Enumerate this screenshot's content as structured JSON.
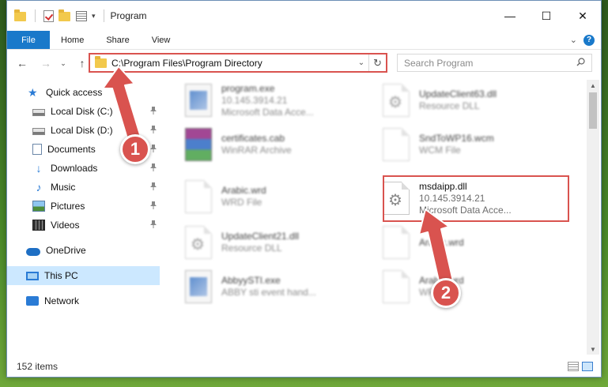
{
  "window": {
    "title": "Program",
    "controls": {
      "minimize": "—",
      "maximize": "☐",
      "close": "✕"
    }
  },
  "ribbon": {
    "tabs": [
      "File",
      "Home",
      "Share",
      "View"
    ]
  },
  "address_bar": {
    "path": "C:\\Program Files\\Program Directory"
  },
  "search": {
    "placeholder": "Search Program"
  },
  "sidebar": {
    "items": [
      {
        "label": "Quick access",
        "icon": "star-icon"
      },
      {
        "label": "Local Disk (C:)",
        "icon": "drive-icon",
        "pinned": true
      },
      {
        "label": "Local Disk (D:)",
        "icon": "drive-icon",
        "pinned": true
      },
      {
        "label": "Documents",
        "icon": "documents-icon",
        "pinned": true
      },
      {
        "label": "Downloads",
        "icon": "download-icon",
        "pinned": true
      },
      {
        "label": "Music",
        "icon": "music-icon",
        "pinned": true
      },
      {
        "label": "Pictures",
        "icon": "pictures-icon",
        "pinned": true
      },
      {
        "label": "Videos",
        "icon": "videos-icon",
        "pinned": true
      },
      {
        "label": "OneDrive",
        "icon": "onedrive-icon"
      },
      {
        "label": "This PC",
        "icon": "pc-icon",
        "selected": true
      },
      {
        "label": "Network",
        "icon": "network-icon"
      }
    ]
  },
  "files": [
    {
      "name": "program.exe",
      "line2": "10.145.3914.21",
      "line3": "Microsoft Data Acce...",
      "icon": "exe-icon",
      "blurred": true
    },
    {
      "name": "UpdateClient63.dll",
      "line2": "Resource DLL",
      "line3": "",
      "icon": "dll-icon",
      "blurred": true
    },
    {
      "name": "certificates.cab",
      "line2": "WinRAR Archive",
      "line3": "",
      "icon": "archive-icon",
      "blurred": true
    },
    {
      "name": "SndToWP16.wcm",
      "line2": "WCM File",
      "line3": "",
      "icon": "file-icon",
      "blurred": true
    },
    {
      "name": "Arabic.wrd",
      "line2": "WRD File",
      "line3": "",
      "icon": "file-icon",
      "blurred": true
    },
    {
      "name": "msdaipp.dll",
      "line2": "10.145.3914.21",
      "line3": "Microsoft Data Acce...",
      "icon": "dll-icon",
      "blurred": false
    },
    {
      "name": "UpdateClient21.dll",
      "line2": "Resource DLL",
      "line3": "",
      "icon": "dll-icon",
      "blurred": true
    },
    {
      "name": "Arabic.wrd",
      "line2": "",
      "line3": "",
      "icon": "file-icon",
      "blurred": true
    },
    {
      "name": "AbbyySTI.exe",
      "line2": "ABBY sti event hand...",
      "line3": "",
      "icon": "exe-icon",
      "blurred": true
    },
    {
      "name": "Arabic.wrd",
      "line2": "WRD File",
      "line3": "",
      "icon": "file-icon",
      "blurred": true
    }
  ],
  "status": {
    "items_count": "152 items"
  },
  "annotations": {
    "badge1": "1",
    "badge2": "2",
    "color": "#d9534f"
  }
}
